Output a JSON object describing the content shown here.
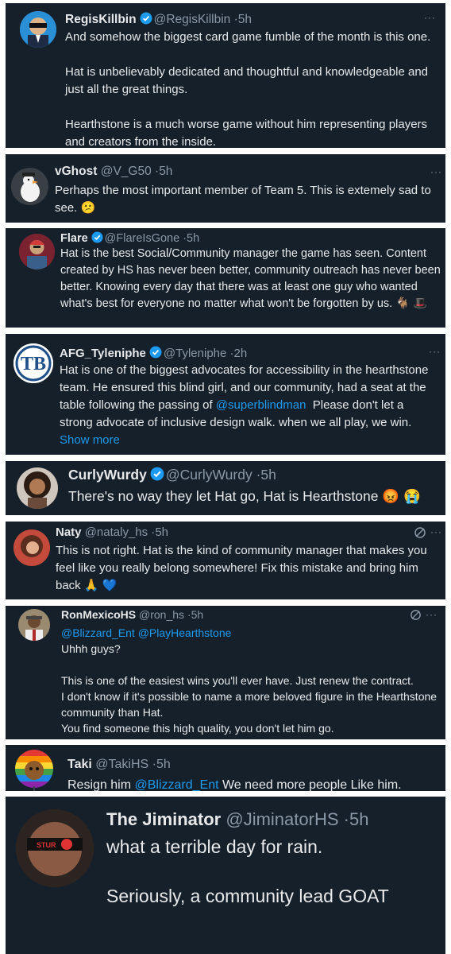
{
  "tweets": [
    {
      "name": "RegisKillbin",
      "handle": "@RegisKillbin",
      "time": "5h",
      "text": "And somehow the biggest card game fumble of the month is this one.\n\nHat is unbelievably dedicated and thoughtful and knowledgeable and just all the great things.\n\nHearthstone is a much worse game without him representing players and creators from the inside."
    },
    {
      "name": "vGhost",
      "handle": "@V_G50",
      "time": "5h",
      "text": "Perhaps the most important member of Team 5. This is extemely sad to see. 😕"
    },
    {
      "name": "Flare",
      "handle": "@FlareIsGone",
      "time": "5h",
      "text": "Hat is the best Social/Community manager the game has seen. Content created by HS has never been better, community outreach has never been better. Knowing every day that there was at least one guy who wanted what's best for everyone no matter what won't be forgotten by us. 🐐 🎩"
    },
    {
      "name": "AFG_Tyleniphe",
      "handle": "@Tyleniphe",
      "time": "2h",
      "text_before": "Hat is one of the biggest advocates for accessibility in the hearthstone team. He ensured this blind girl, and our community, had a seat at the table following the passing of ",
      "mention": "@superblindman",
      "text_after": "  Please don't let a strong advocate of inclusive design walk. when we all play, we win. ",
      "show_more": "Show more"
    },
    {
      "name": "CurlyWurdy",
      "handle": "@CurlyWurdy",
      "time": "5h",
      "text": "There's no way they let Hat go, Hat is Hearthstone 😡 😭"
    },
    {
      "name": "Naty",
      "handle": "@nataly_hs",
      "time": "5h",
      "text": "This is not right. Hat is the kind of community manager that makes you feel like you really belong somewhere! Fix this mistake and bring him back 🙏 💙"
    },
    {
      "name": "RonMexicoHS",
      "handle": "@ron_hs",
      "time": "5h",
      "mentions": "@Blizzard_Ent @PlayHearthstone",
      "text": "Uhhh guys?\n\nThis is one of the easiest wins you'll ever have. Just renew the contract.\nI don't know if it's possible to name a more beloved figure in the Hearthstone community than Hat.\nYou find someone this high quality, you don't let him go."
    },
    {
      "name": "Taki",
      "handle": "@TakiHS",
      "time": "5h",
      "text_before": "Resign him ",
      "mention": "@Blizzard_Ent",
      "text_after": " We need more people Like him."
    },
    {
      "name": "The Jiminator",
      "handle": "@JiminatorHS",
      "time": "5h",
      "text": "what a terrible day for rain.\n\nSeriously, a community lead GOAT"
    }
  ],
  "separator": "·",
  "more_glyph": "···",
  "colors": {
    "card_bg": "#15202b",
    "text": "#e7e9ea",
    "muted": "#8b98a5",
    "link": "#1d9bf0",
    "verified": "#1d9bf0"
  },
  "icons": [
    "verified-badge-icon",
    "more-options-icon",
    "grok-icon"
  ]
}
